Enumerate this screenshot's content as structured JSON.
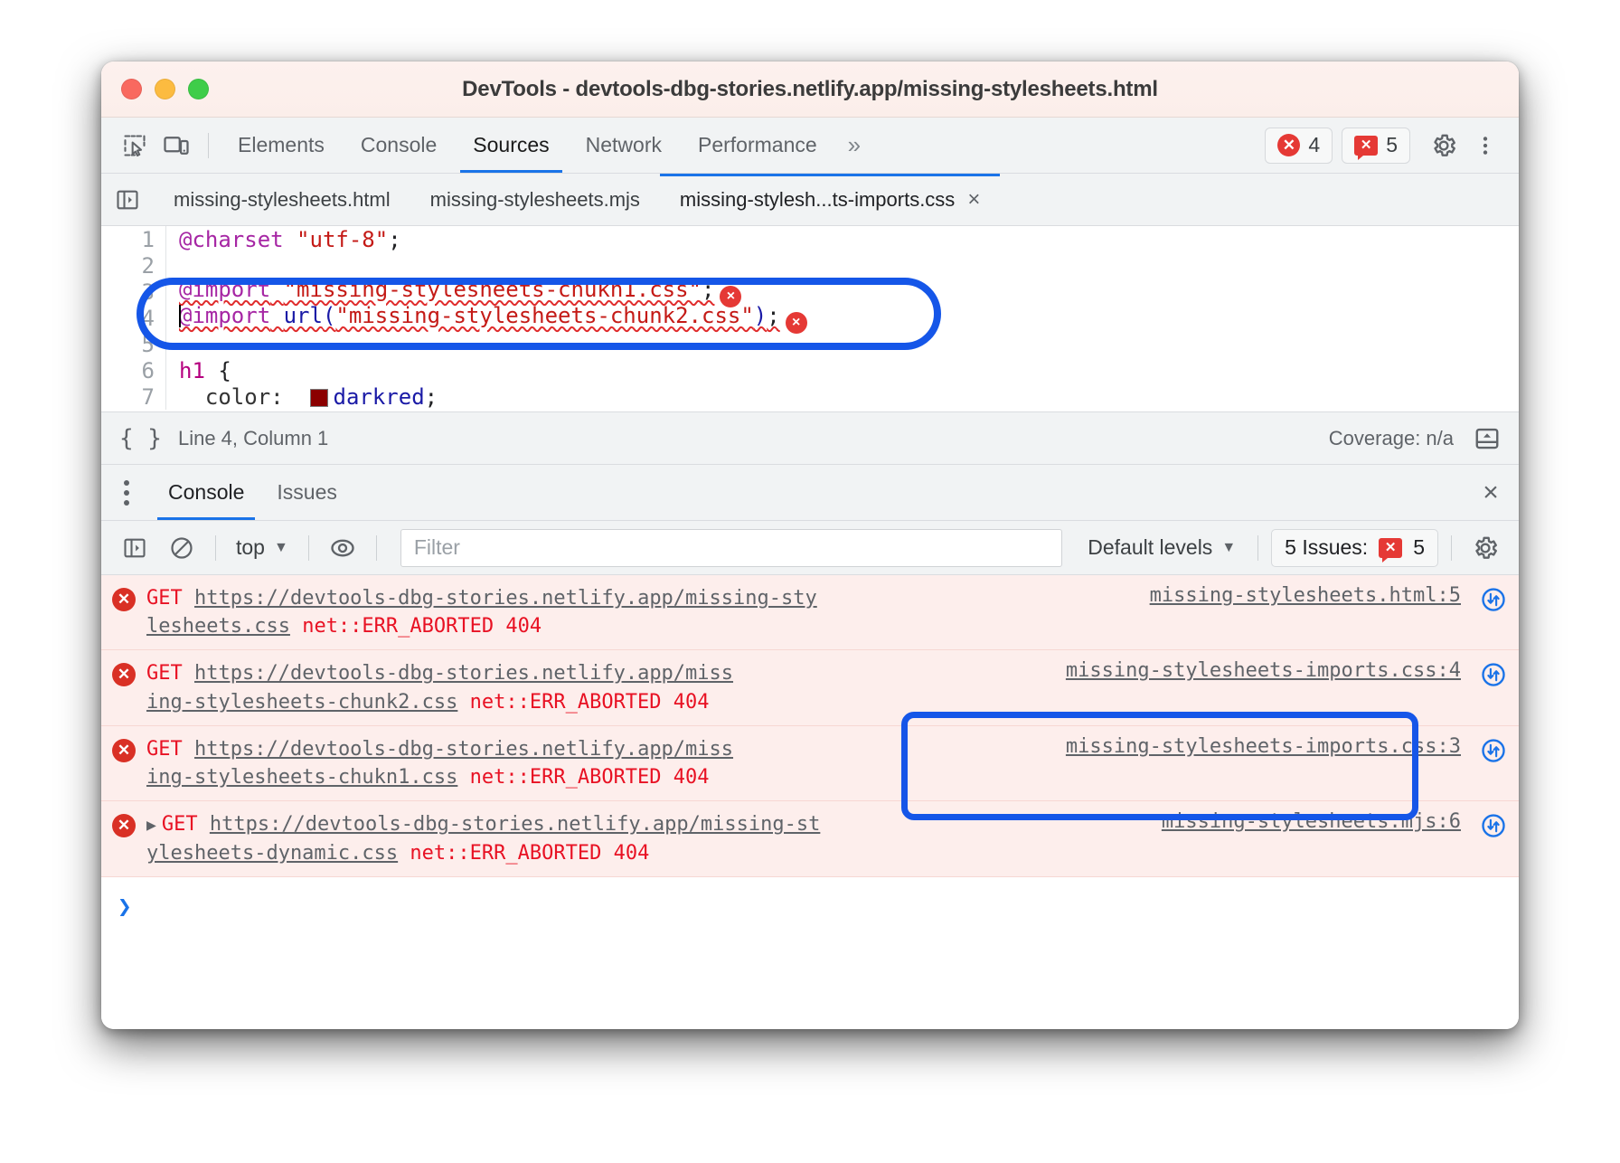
{
  "window": {
    "title": "DevTools - devtools-dbg-stories.netlify.app/missing-stylesheets.html",
    "traffic_lights": [
      "close",
      "minimize",
      "zoom"
    ]
  },
  "toolbar": {
    "inspect_icon": "inspect-element-icon",
    "device_icon": "device-toolbar-icon",
    "panels": [
      {
        "label": "Elements",
        "active": false
      },
      {
        "label": "Console",
        "active": false
      },
      {
        "label": "Sources",
        "active": true
      },
      {
        "label": "Network",
        "active": false
      },
      {
        "label": "Performance",
        "active": false
      }
    ],
    "more_panels_label": "»",
    "error_badge_count": "4",
    "issues_badge_count": "5",
    "settings_icon": "gear-icon",
    "more_options_icon": "kebab-menu-icon"
  },
  "file_tabs": {
    "navigator_toggle_icon": "show-navigator-icon",
    "tabs": [
      {
        "label": "missing-stylesheets.html",
        "active": false,
        "closable": false
      },
      {
        "label": "missing-stylesheets.mjs",
        "active": false,
        "closable": false
      },
      {
        "label": "missing-stylesh...ts-imports.css",
        "active": true,
        "closable": true
      }
    ],
    "close_label": "×"
  },
  "editor": {
    "lines": [
      {
        "number": "1",
        "type": "charset"
      },
      {
        "number": "2",
        "type": "blank"
      },
      {
        "number": "3",
        "type": "import_str"
      },
      {
        "number": "4",
        "type": "import_url"
      },
      {
        "number": "5",
        "type": "blank"
      },
      {
        "number": "6",
        "type": "selector"
      },
      {
        "number": "7",
        "type": "declaration"
      }
    ],
    "line1": {
      "at": "@charset",
      "space": " ",
      "value": "\"utf-8\"",
      "semi": ";"
    },
    "line3": {
      "at": "@import",
      "space": " ",
      "value": "\"missing-stylesheets-chukn1.css\"",
      "semi": ";",
      "error": "×"
    },
    "line4": {
      "at": "@import",
      "space": " ",
      "fn": "url",
      "open": "(",
      "value": "\"missing-stylesheets-chunk2.css\"",
      "close": ")",
      "semi": ";",
      "error": "×"
    },
    "line6": {
      "selector": "h1",
      "brace": " {"
    },
    "line7": {
      "prop": "  color:  ",
      "swatch_color": "#8b0000",
      "value": "darkred",
      "semi": ";"
    }
  },
  "editor_status": {
    "format_icon": "pretty-print-icon",
    "position": "Line 4, Column 1",
    "coverage": "Coverage: n/a",
    "drawer_toggle_icon": "toggle-drawer-icon"
  },
  "drawer": {
    "more_icon": "kebab-menu-icon",
    "tabs": [
      {
        "label": "Console",
        "active": true
      },
      {
        "label": "Issues",
        "active": false
      }
    ],
    "close_label": "×"
  },
  "console_toolbar": {
    "sidebar_icon": "console-sidebar-icon",
    "clear_icon": "clear-console-icon",
    "context": "top",
    "context_caret": "▼",
    "live_expression_icon": "eye-icon",
    "filter_placeholder": "Filter",
    "filter_value": "",
    "levels_label": "Default levels",
    "levels_caret": "▼",
    "issues_label": "5 Issues:",
    "issues_count": "5",
    "settings_icon": "gear-icon"
  },
  "console_messages": [
    {
      "level": "error",
      "expandable": false,
      "get": "GET",
      "url": "https://devtools-dbg-stories.netlify.app/missing-sty",
      "url2": "lesheets.css",
      "error": "net::ERR_ABORTED 404",
      "source": "missing-stylesheets.html:5",
      "request_icon": "network-request-icon",
      "highlighted": false
    },
    {
      "level": "error",
      "expandable": false,
      "get": "GET",
      "url": "https://devtools-dbg-stories.netlify.app/miss",
      "url2": "ing-stylesheets-chunk2.css",
      "error": "net::ERR_ABORTED 404",
      "source": "missing-stylesheets-imports.css:4",
      "request_icon": "network-request-icon",
      "highlighted": true
    },
    {
      "level": "error",
      "expandable": false,
      "get": "GET",
      "url": "https://devtools-dbg-stories.netlify.app/miss",
      "url2": "ing-stylesheets-chukn1.css",
      "error": "net::ERR_ABORTED 404",
      "source": "missing-stylesheets-imports.css:3",
      "request_icon": "network-request-icon",
      "highlighted": true
    },
    {
      "level": "error",
      "expandable": true,
      "disclosure": "▶",
      "get": "GET",
      "url": "https://devtools-dbg-stories.netlify.app/missing-st",
      "url2": "ylesheets-dynamic.css",
      "error": "net::ERR_ABORTED 404",
      "source": "missing-stylesheets.mjs:6",
      "request_icon": "network-request-icon",
      "highlighted": false
    }
  ],
  "console_prompt": {
    "arrow": "❯",
    "value": ""
  },
  "annotations": {
    "editor_ring_color": "#1556e8",
    "console_ring_color": "#1556e8"
  }
}
